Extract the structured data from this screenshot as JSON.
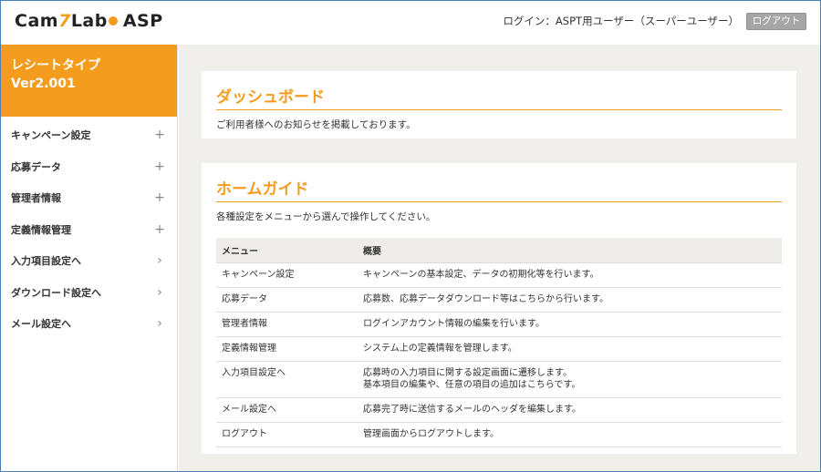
{
  "header": {
    "logo_pre": "Cam",
    "logo_seven": "7",
    "logo_mid": "Lab",
    "logo_post": "ASP",
    "login_info": "ログイン：ASPT用ユーザー（スーパーユーザー）",
    "logout_label": "ログアウト"
  },
  "sidebar": {
    "title_line1": "レシートタイプ",
    "title_line2": "Ver2.001",
    "items": [
      {
        "label": "キャンペーン設定",
        "mark": "+"
      },
      {
        "label": "応募データ",
        "mark": "+"
      },
      {
        "label": "管理者情報",
        "mark": "+"
      },
      {
        "label": "定義情報管理",
        "mark": "+"
      },
      {
        "label": "入力項目設定へ",
        "mark": "›"
      },
      {
        "label": "ダウンロード設定へ",
        "mark": "›"
      },
      {
        "label": "メール設定へ",
        "mark": "›"
      }
    ]
  },
  "dashboard": {
    "title": "ダッシュボード",
    "text": "ご利用者様へのお知らせを掲載しております。"
  },
  "guide": {
    "title": "ホームガイド",
    "text": "各種設定をメニューから選んで操作してください。",
    "headers": [
      "メニュー",
      "概要"
    ],
    "rows": [
      {
        "menu": "キャンペーン設定",
        "desc": "キャンペーンの基本設定、データの初期化等を行います。",
        "desc2": ""
      },
      {
        "menu": "応募データ",
        "desc": "応募数、応募データダウンロード等はこちらから行います。",
        "desc2": ""
      },
      {
        "menu": "管理者情報",
        "desc": "ログインアカウント情報の編集を行います。",
        "desc2": ""
      },
      {
        "menu": "定義情報管理",
        "desc": "システム上の定義情報を管理します。",
        "desc2": ""
      },
      {
        "menu": "入力項目設定へ",
        "desc": "応募時の入力項目に関する設定画面に遷移します。",
        "desc2": "基本項目の編集や、任意の項目の追加はこちらです。"
      },
      {
        "menu": "メール設定へ",
        "desc": "応募完了時に送信するメールのヘッダを編集します。",
        "desc2": ""
      },
      {
        "menu": "ログアウト",
        "desc": "管理画面からログアウトします。",
        "desc2": ""
      }
    ]
  },
  "colors": {
    "accent": "#f39c1e",
    "main_bg": "#f0efeb",
    "logout_bg": "#a6a6a6"
  }
}
